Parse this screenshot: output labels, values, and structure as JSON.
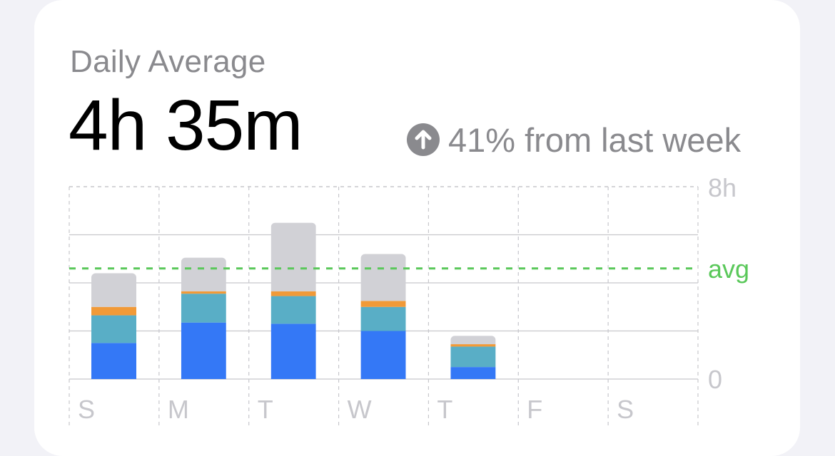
{
  "summary": {
    "title": "Daily Average",
    "value": "4h 35m",
    "change_text": "41% from last week",
    "change_icon": "arrow-up-circle-icon"
  },
  "chart_data": {
    "type": "bar",
    "stacked": true,
    "categories": [
      "S",
      "M",
      "T",
      "W",
      "T",
      "F",
      "S"
    ],
    "series": [
      {
        "color": "#3478f6",
        "values": [
          1.5,
          2.35,
          2.3,
          2.0,
          0.5,
          null,
          null
        ]
      },
      {
        "color": "#59aec6",
        "values": [
          1.15,
          1.2,
          1.15,
          1.0,
          0.85,
          null,
          null
        ]
      },
      {
        "color": "#f19a38",
        "values": [
          0.35,
          0.1,
          0.2,
          0.25,
          0.1,
          null,
          null
        ]
      },
      {
        "color": "#d1d1d6",
        "values": [
          1.4,
          1.4,
          2.85,
          1.95,
          0.35,
          null,
          null
        ]
      }
    ],
    "ylim": [
      0,
      8
    ],
    "y_tick_labels": [
      "8h",
      "0"
    ],
    "average": {
      "label": "avg",
      "value": 4.6,
      "color": "#5ac85a"
    },
    "grid": true
  }
}
